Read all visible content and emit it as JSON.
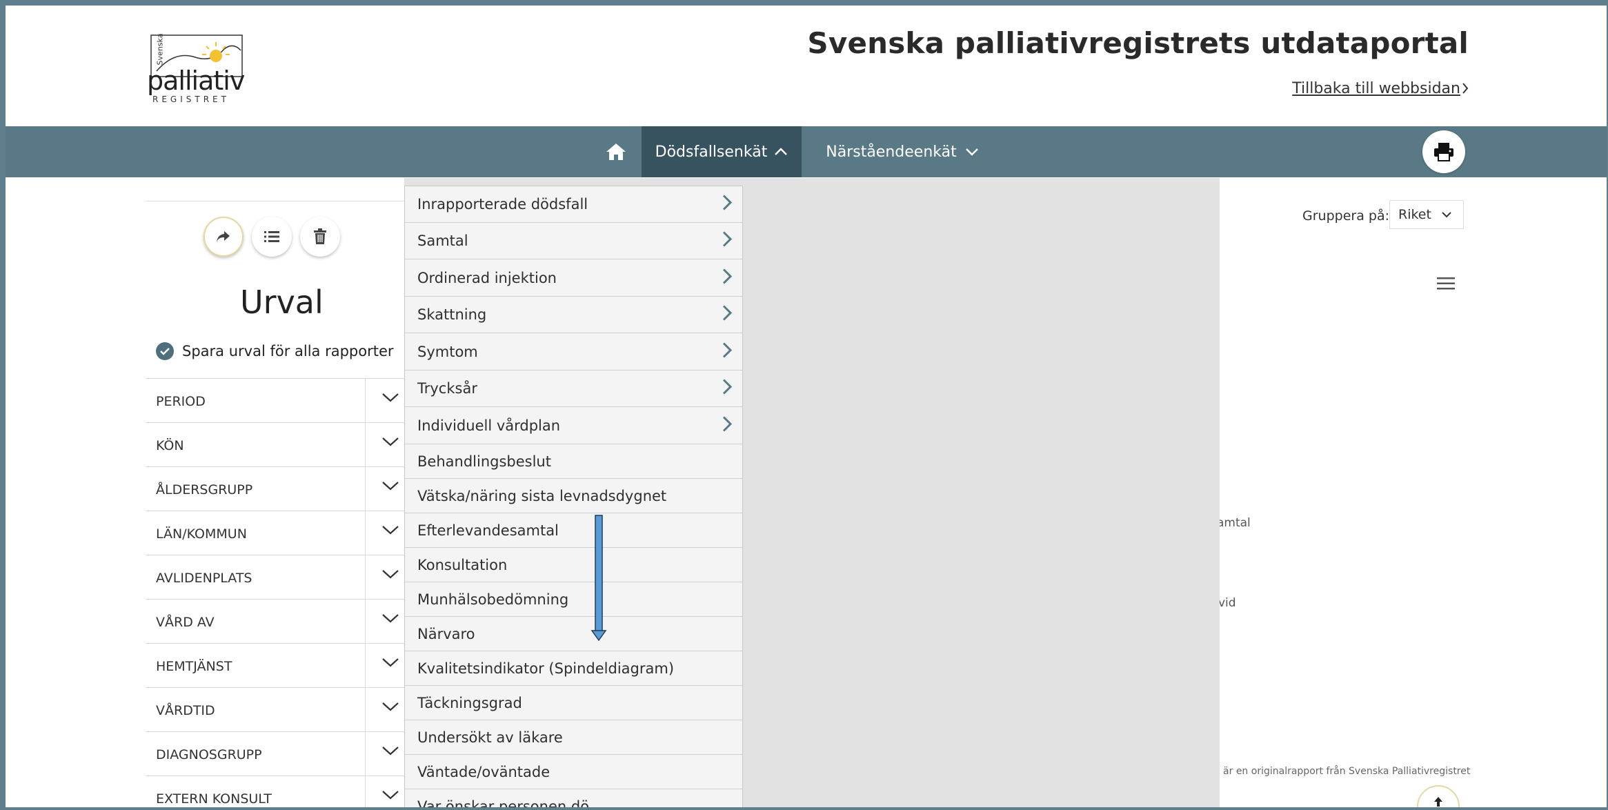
{
  "header": {
    "logo_small": "Svenska",
    "logo_main": "palliativ",
    "logo_sub": "REGISTRET",
    "title": "Svenska palliativregistrets utdataportal",
    "back_link": "Tillbaka till webbsidan"
  },
  "nav": {
    "home_icon": "home-icon",
    "items": [
      {
        "label": "Dödsfallsenkät",
        "state": "open"
      },
      {
        "label": "Närståendeenkät",
        "state": "closed"
      }
    ],
    "print_icon": "printer-icon"
  },
  "left_panel": {
    "title": "Urval",
    "save_all_label": "Spara urval för alla rapporter",
    "filters": [
      "PERIOD",
      "KÖN",
      "ÅLDERSGRUPP",
      "LÄN/KOMMUN",
      "AVLIDENPLATS",
      "VÅRD AV",
      "HEMTJÄNST",
      "VÅRDTID",
      "DIAGNOSGRUPP",
      "EXTERN KONSULT"
    ]
  },
  "right_panel": {
    "group_label": "Gruppera på:",
    "group_value": "Riket",
    "fragment_1": "amtal",
    "fragment_2": "vid",
    "footer_fragment": "a är en originalrapport från Svenska Palliativregistret"
  },
  "dropdown": {
    "items": [
      {
        "label": "Inrapporterade dödsfall",
        "has_sub": true
      },
      {
        "label": "Samtal",
        "has_sub": true
      },
      {
        "label": "Ordinerad injektion",
        "has_sub": true
      },
      {
        "label": "Skattning",
        "has_sub": true
      },
      {
        "label": "Symtom",
        "has_sub": true
      },
      {
        "label": "Trycksår",
        "has_sub": true
      },
      {
        "label": "Individuell vårdplan",
        "has_sub": true
      },
      {
        "label": "Behandlingsbeslut",
        "has_sub": false
      },
      {
        "label": "Vätska/näring sista levnadsdygnet",
        "has_sub": false
      },
      {
        "label": "Efterlevandesamtal",
        "has_sub": false
      },
      {
        "label": "Konsultation",
        "has_sub": false
      },
      {
        "label": "Munhälsobedömning",
        "has_sub": false
      },
      {
        "label": "Närvaro",
        "has_sub": false
      },
      {
        "label": "Kvalitetsindikator (Spindeldiagram)",
        "has_sub": false
      },
      {
        "label": "Täckningsgrad",
        "has_sub": false
      },
      {
        "label": "Undersökt av läkare",
        "has_sub": false
      },
      {
        "label": "Väntade/oväntade",
        "has_sub": false
      },
      {
        "label": "Var önskar personen dö",
        "has_sub": false
      }
    ]
  },
  "colors": {
    "navbar": "#587985",
    "navbar_active": "#385360",
    "accent": "#4f6f7d",
    "arrow": "#5b9bd5"
  }
}
